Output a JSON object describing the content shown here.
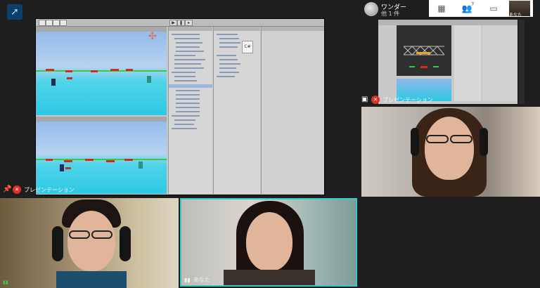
{
  "header": {
    "room_name": "ワンダー",
    "room_sub": "他 1 件",
    "self_label": "あなた",
    "icons": [
      "grid-icon",
      "people-icon",
      "chat-icon"
    ],
    "people_count": "7"
  },
  "main_share": {
    "caption": "プレゼンテーション"
  },
  "thumb_share": {
    "caption": "プレゼンテーション"
  },
  "tiles": [
    {
      "name": "participant-girl-glasses",
      "caption": ""
    },
    {
      "name": "participant-boy-glasses",
      "caption": ""
    },
    {
      "name": "participant-girl-center",
      "caption": "あなた"
    }
  ],
  "unity": {
    "project_file": "C#"
  },
  "colors": {
    "mic_off": "#d9342b",
    "active_speaker_border": "#38c7c7",
    "platform": "#d12b1f",
    "floor": "#2ec9e4"
  }
}
